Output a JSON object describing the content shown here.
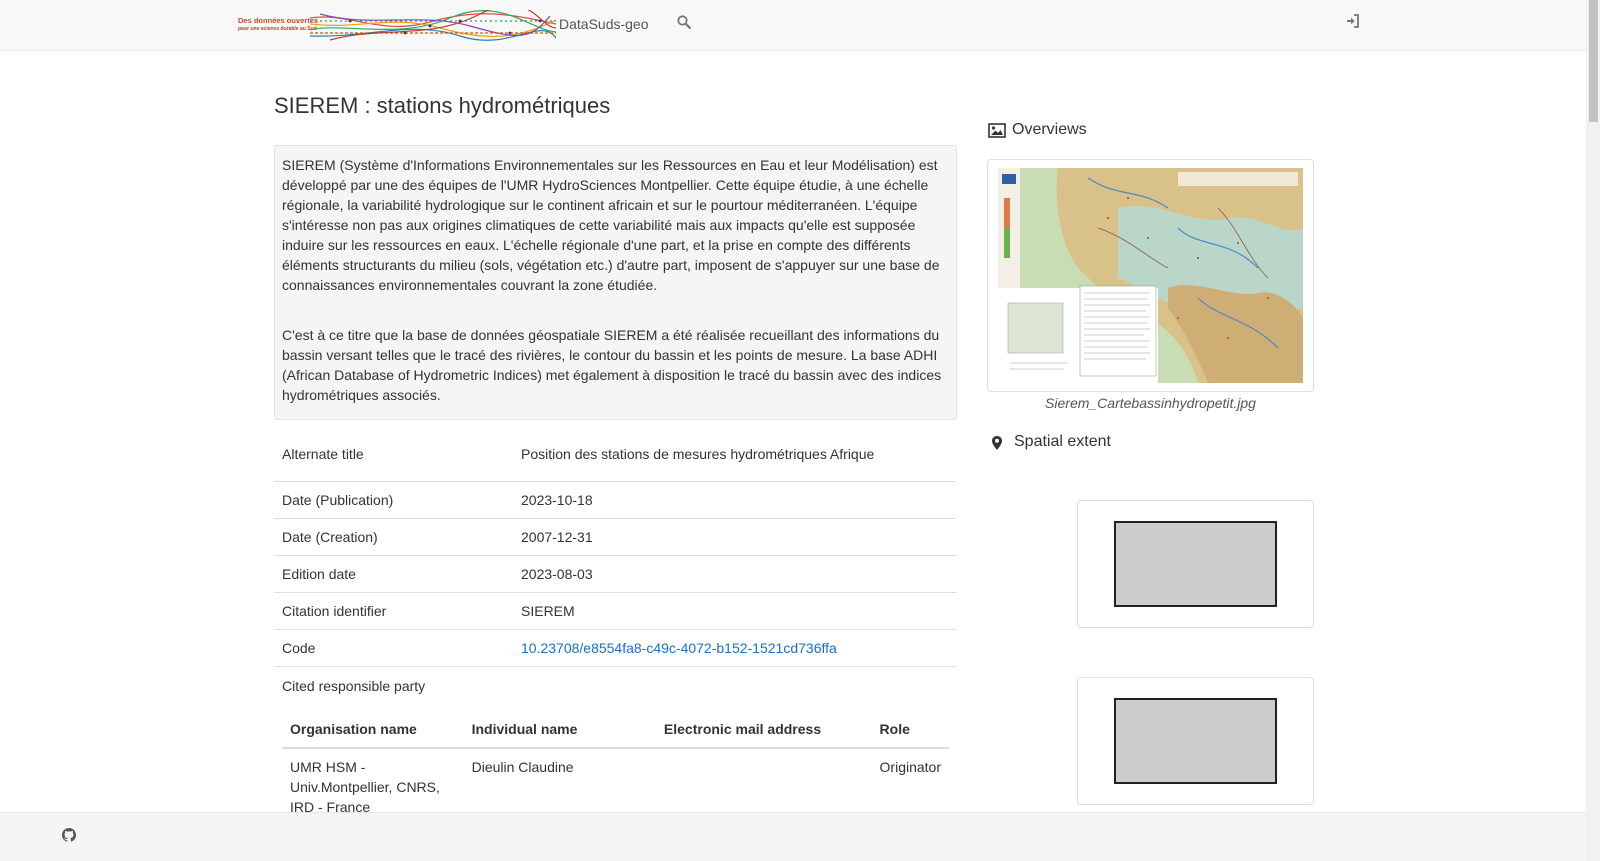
{
  "navbar": {
    "logo_line1": "Des données ouvertes",
    "logo_line2": "pour une science durable au Sud",
    "site_name": "DataSuds-geo",
    "search_icon": "search-icon",
    "login_icon": "sign-in-icon"
  },
  "record": {
    "title": "SIEREM : stations hydrométriques",
    "abstract_p1": "SIEREM (Système d'Informations Environnementales sur les Ressources en Eau et leur Modélisation) est développé par une des équipes de l'UMR HydroSciences Montpellier. Cette équipe étudie, à une échelle régionale, la variabilité hydrologique sur le continent africain et sur le pourtour méditerranéen. L'équipe s'intéresse non pas aux origines climatiques de cette variabilité mais aux impacts qu'elle est supposée induire sur les ressources en eaux. L'échelle régionale d'une part, et la prise en compte des différents éléments structurants du milieu (sols, végétation etc.) d'autre part, imposent de s'appuyer sur une base de connaissances environnementales couvrant la zone étudiée.",
    "abstract_p2": "C'est à ce titre que la base de données géospatiale SIEREM a été réalisée recueillant des informations du bassin versant telles que le tracé des rivières, le contour du bassin et les points de mesure. La base ADHI (African Database of Hydrometric Indices) met également à disposition le tracé du bassin avec des indices hydrométriques associés."
  },
  "metadata": {
    "alternate_title_label": "Alternate title",
    "alternate_title_value": "Position des stations de mesures hydrométriques Afrique",
    "date_publication_label": "Date (Publication)",
    "date_publication_value": "2023-10-18",
    "date_creation_label": "Date (Creation)",
    "date_creation_value": "2007-12-31",
    "edition_date_label": "Edition date",
    "edition_date_value": "2023-08-03",
    "citation_identifier_label": "Citation identifier",
    "citation_identifier_value": "SIEREM",
    "code_label": "Code",
    "code_value": "10.23708/e8554fa8-c49c-4072-b152-1521cd736ffa",
    "cited_party_label": "Cited responsible party"
  },
  "party_table": {
    "headers": [
      "Organisation name",
      "Individual name",
      "Electronic mail address",
      "Role"
    ],
    "rows": [
      {
        "organisation": "UMR HSM - Univ.Montpellier, CNRS, IRD - France",
        "individual": "Dieulin Claudine",
        "email": "",
        "role": "Originator"
      }
    ]
  },
  "sidebar": {
    "overviews_heading": "Overviews",
    "overviews_icon": "image-icon",
    "overview_caption": "Sierem_Cartebassinhydropetit.jpg",
    "spatial_extent_heading": "Spatial extent",
    "spatial_extent_icon": "map-marker-icon"
  },
  "footer": {
    "github_icon": "github-icon"
  }
}
